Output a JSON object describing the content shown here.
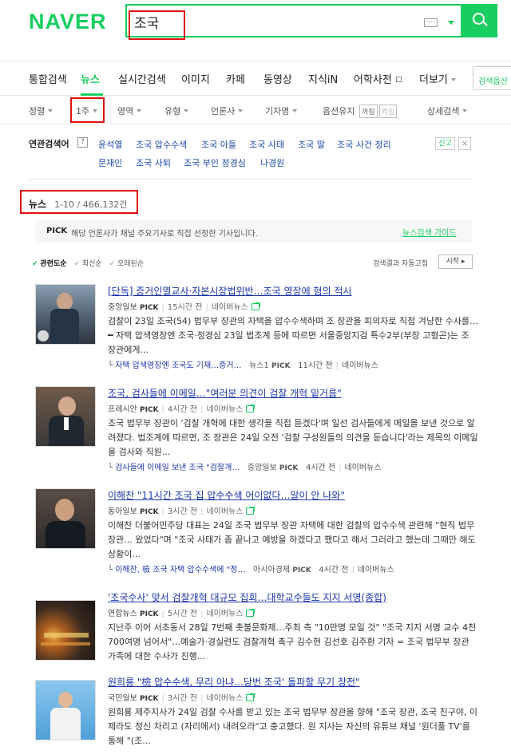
{
  "header": {
    "logo": "NAVER",
    "query": "조국"
  },
  "tabs": [
    {
      "label": "통합검색"
    },
    {
      "label": "뉴스"
    },
    {
      "label": "실시간검색"
    },
    {
      "label": "이미지"
    },
    {
      "label": "카페"
    },
    {
      "label": "동영상"
    },
    {
      "label": "지식iN"
    },
    {
      "label": "어학사전"
    },
    {
      "label": "더보기"
    },
    {
      "label": "검색옵션"
    }
  ],
  "options": {
    "sort": "정렬",
    "period": "1주",
    "area": "영역",
    "type": "유형",
    "press": "언론사",
    "reporter": "기자명",
    "keep": "옵션유지",
    "keep_on": "꺼짐",
    "keep_off": "켜짐",
    "detail": "상세검색"
  },
  "related": {
    "title": "연관검색어",
    "help": "?",
    "keywords": [
      "윤석열",
      "조국 압수수색",
      "조국 아들",
      "조국 사태",
      "조국 딸",
      "조국 사건 정리",
      "문재인",
      "조국 사퇴",
      "조국 부인 정경심",
      "나경원"
    ],
    "report": "신고",
    "close": "×"
  },
  "section": {
    "title": "뉴스",
    "count": "1-10 / 466,132건"
  },
  "pick": {
    "badge": "PICK",
    "text": "해당 언론사가 채널 주요기사로 직접 선정한 기사입니다.",
    "guide": "뉴스검색 가이드"
  },
  "sort": {
    "relevance": "관련도순",
    "latest": "최신순",
    "oldest": "오래된순",
    "auto": "검색결과 자동고침",
    "start": "시작"
  },
  "articles": [
    {
      "title": "[단독] 증거인멸교사·자본시장법위반…조국 영장에 혐의 적시",
      "source": "중앙일보",
      "pick": "PICK",
      "time": "15시간 전",
      "portal": "네이버뉴스",
      "body": "검찰이 23일 조국(54) 법무부 장관의 자택을 압수수색하며 조 장관을 피의자로 직접 겨냥한 수사를… ━ 자택 압색영장엔 조국·정경심 23일 법조계 등에 따르면 서울중앙지검 특수2부(부장 고형곤)는 조 장관에게...",
      "sub": {
        "title": "자택 압색영장엔 조국도 기재…증거…",
        "source": "뉴스1",
        "pick": "PICK",
        "time": "11시간 전",
        "portal": "네이버뉴스"
      }
    },
    {
      "title": "조국, 검사들에 이메일…\"여러분 의견이 검찰 개혁 밑거름\"",
      "source": "프레시안",
      "pick": "PICK",
      "time": "4시간 전",
      "portal": "네이버뉴스",
      "body": "조국 법무부 장관이 '검찰 개혁에 대한 생각을 직접 듣겠다'며 일선 검사들에게 메일을 보낸 것으로 알려졌다. 법조계에 따르면, 조 장관은 24일 오전 '검찰 구성원들의 의견을 듣습니다'라는 제목의 이메일을 검사와 직원...",
      "sub": {
        "title": "검사들에 이메일 보낸 조국 \"검찰개…",
        "source": "중앙일보",
        "pick": "PICK",
        "time": "4시간 전",
        "portal": "네이버뉴스"
      }
    },
    {
      "title": "이해찬 \"11시간 조국 집 압수수색 어이없다…말이 안 나와\"",
      "source": "동아일보",
      "pick": "PICK",
      "time": "3시간 전",
      "portal": "네이버뉴스",
      "body": "이해찬 더불어민주당 대표는 24일 조국 법무부 장관 자택에 대한 검찰의 압수수색 관련해 \"현직 법무장관... 왔었다\"며 \"조국 사태가 좀 끝나고 예방을 하겠다고 했다고 해서 그러라고 했는데 그때만 해도 상황이...",
      "sub": {
        "title": "이해찬, 檢 조국 자택 압수수색에 \"정…",
        "source": "아시아경제",
        "pick": "PICK",
        "time": "4시간 전",
        "portal": "네이버뉴스"
      }
    },
    {
      "title": "'조국수사' 맞서 검찰개혁 대규모 집회…대학교수들도 지지 서명(종합)",
      "source": "연합뉴스",
      "pick": "PICK",
      "time": "5시간 전",
      "portal": "네이버뉴스",
      "body": "지난주 이어 서초동서 28일 7번째 촛불문화제…주최 측 \"10만명 모일 것\" \"조국 지지 서명 교수 4천700여명 넘어서\"…예술가·경실련도 검찰개혁 촉구 김수현 김선호 김주환 기자 = 조국 법무부 장관 가족에 대한 수사가 진행..."
    },
    {
      "title": "원희룡 \"檢 압수수색, 무리 아냐…당번 조국' 돌파할 무기 장전\"",
      "source": "국민일보",
      "pick": "PICK",
      "time": "3시간 전",
      "portal": "네이버뉴스",
      "body": "원희룡 제주지사가 24일 검찰 수사를 받고 있는 조국 법무부 장관을 향해 \"조국 장관, 조국 친구야, 이제라도 정신 차리고 (자리에서) 내려오라\"고 충고했다. 원 지사는 자신의 유튜브 채널 '원더풀 TV'를 통해 \"(조..."
    }
  ],
  "colors": {
    "brand": "#19ce60",
    "highlight": "#e01010",
    "link": "#1a35a8"
  }
}
